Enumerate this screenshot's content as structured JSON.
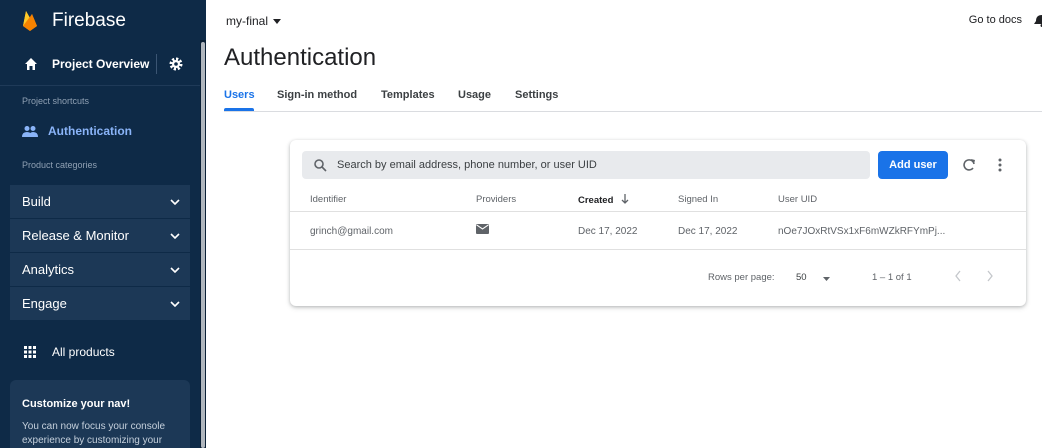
{
  "colors": {
    "sidebar_bg": "#0e2a47",
    "accent": "#1a73e8",
    "sidebar_active": "#8ab4f8"
  },
  "sidebar": {
    "brand": "Firebase",
    "project_overview": "Project Overview",
    "shortcuts_title": "Project shortcuts",
    "shortcut_item": "Authentication",
    "categories_title": "Product categories",
    "categories": [
      "Build",
      "Release & Monitor",
      "Analytics",
      "Engage"
    ],
    "all_products": "All products",
    "customize_title": "Customize your nav!",
    "customize_text": "You can now focus your console experience by customizing your"
  },
  "topbar": {
    "project": "my-final",
    "docs": "Go to docs"
  },
  "page": {
    "title": "Authentication"
  },
  "tabs": [
    "Users",
    "Sign-in method",
    "Templates",
    "Usage",
    "Settings"
  ],
  "users_card": {
    "search_placeholder": "Search by email address, phone number, or user UID",
    "add_user": "Add user",
    "columns": [
      "Identifier",
      "Providers",
      "Created",
      "Signed In",
      "User UID"
    ],
    "rows": [
      {
        "identifier": "grinch@gmail.com",
        "provider_icon": "mail-icon",
        "created": "Dec 17, 2022",
        "signed_in": "Dec 17, 2022",
        "uid": "nOe7JOxRtVSx1xF6mWZkRFYmPj..."
      }
    ],
    "rows_per_page_label": "Rows per page:",
    "rows_per_page": "50",
    "range": "1 – 1 of 1"
  }
}
